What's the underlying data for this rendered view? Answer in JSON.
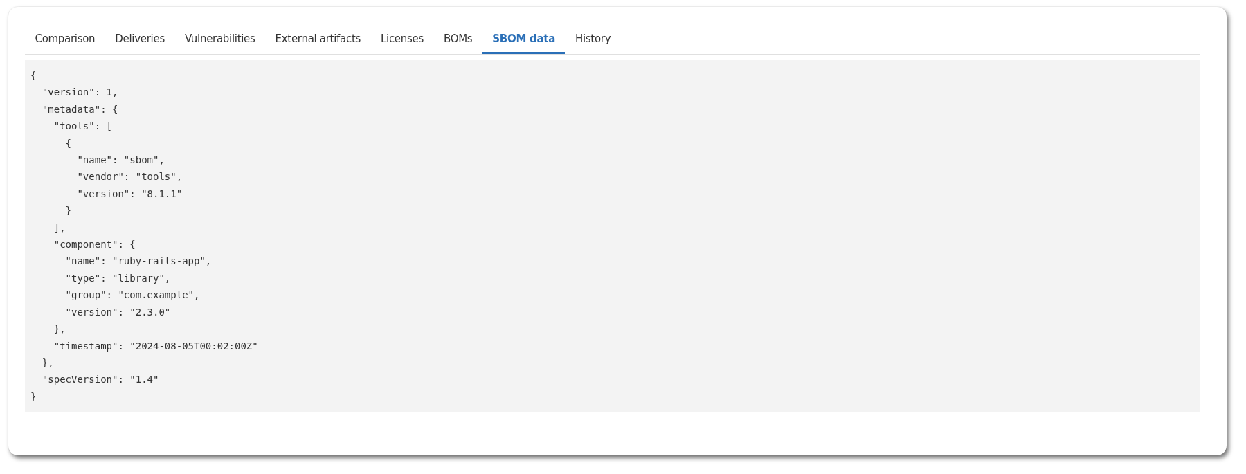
{
  "tabs": [
    {
      "label": "Comparison",
      "selected": false
    },
    {
      "label": "Deliveries",
      "selected": false
    },
    {
      "label": "Vulnerabilities",
      "selected": false
    },
    {
      "label": "External artifacts",
      "selected": false
    },
    {
      "label": "Licenses",
      "selected": false
    },
    {
      "label": "BOMs",
      "selected": false
    },
    {
      "label": "SBOM data",
      "selected": true
    },
    {
      "label": "History",
      "selected": false
    }
  ],
  "code_lines": [
    "{",
    "  \"version\": 1,",
    "  \"metadata\": {",
    "    \"tools\": [",
    "      {",
    "        \"name\": \"sbom\",",
    "        \"vendor\": \"tools\",",
    "        \"version\": \"8.1.1\"",
    "      }",
    "    ],",
    "    \"component\": {",
    "      \"name\": \"ruby-rails-app\",",
    "      \"type\": \"library\",",
    "      \"group\": \"com.example\",",
    "      \"version\": \"2.3.0\"",
    "    },",
    "    \"timestamp\": \"2024-08-05T00:02:00Z\"",
    "  },",
    "  \"specVersion\": \"1.4\"",
    "}"
  ]
}
